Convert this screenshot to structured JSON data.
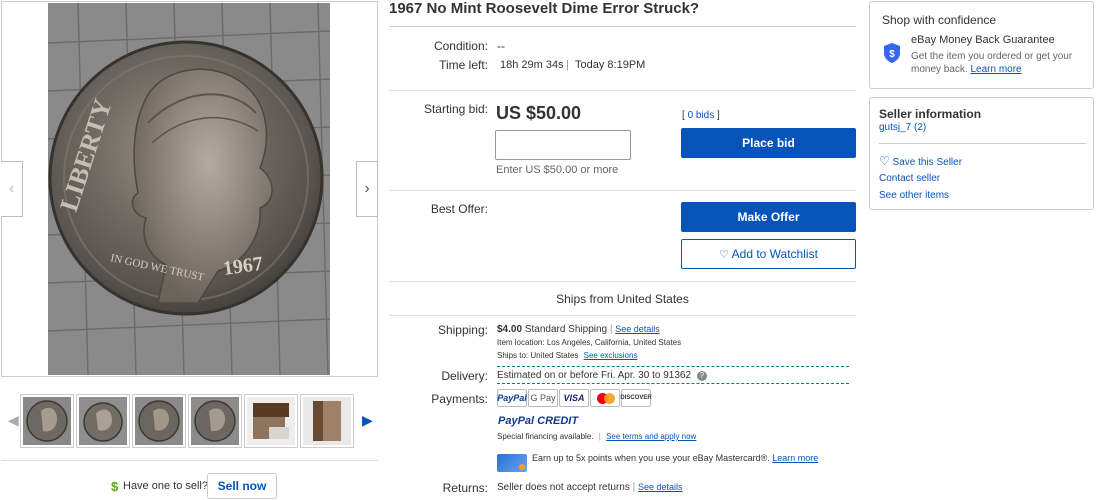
{
  "listing": {
    "title": "1967 No Mint Roosevelt Dime Error Struck?",
    "condition_label": "Condition:",
    "condition_value": "--",
    "time_left_label": "Time left:",
    "time_left_value": "18h 29m 34s",
    "time_left_end": "Today 8:19PM",
    "starting_bid_label": "Starting bid:",
    "price": "US $50.00",
    "bids_link": "0 bids",
    "bids_open": "[",
    "bids_close": "]",
    "bid_input_placeholder": "",
    "bid_hint": "Enter US $50.00 or more",
    "place_bid_label": "Place bid",
    "best_offer_label": "Best Offer:",
    "make_offer_label": "Make Offer",
    "watchlist_label": "Add to Watchlist",
    "ships_from": "Ships from United States"
  },
  "shipping": {
    "label": "Shipping:",
    "cost": "$4.00",
    "method": "Standard Shipping",
    "details_link": "See details",
    "item_location_label": "Item location:",
    "item_location": "Los Angeles, California, United States",
    "ships_to_label": "Ships to:",
    "ships_to": "United States",
    "exclusions_link": "See exclusions"
  },
  "delivery": {
    "label": "Delivery:",
    "text": "Estimated on or before Fri. Apr. 30 to 91362"
  },
  "payments": {
    "label": "Payments:",
    "icons": [
      "PayPal",
      "G Pay",
      "VISA",
      "mastercard",
      "DISCOVER"
    ],
    "paypal_credit": "PayPal CREDIT",
    "financing": "Special financing available.",
    "financing_link": "See terms and apply now",
    "mastercard_promo": "Earn up to 5x points when you use your eBay Mastercard®.",
    "learn_more": "Learn more"
  },
  "returns": {
    "label": "Returns:",
    "text": "Seller does not accept returns",
    "details_link": "See details"
  },
  "confidence": {
    "heading": "Shop with confidence",
    "guarantee_title": "eBay Money Back Guarantee",
    "guarantee_text": "Get the item you ordered or get your money back.",
    "learn_more": "Learn more"
  },
  "seller": {
    "heading": "Seller information",
    "username": "gutsj_7",
    "feedback": "(2)",
    "save_seller": "Save this Seller",
    "contact_seller": "Contact seller",
    "see_other_items": "See other items"
  },
  "gallery": {
    "coin_date": "1967",
    "coin_legend_top": "LIBERTY",
    "coin_motto": "IN GOD WE TRUST",
    "thumbnail_count": 6
  },
  "sell": {
    "prompt": "Have one to sell?",
    "button": "Sell now"
  },
  "colors": {
    "accent": "#0654ba",
    "text": "#333333",
    "border": "#cccccc"
  }
}
